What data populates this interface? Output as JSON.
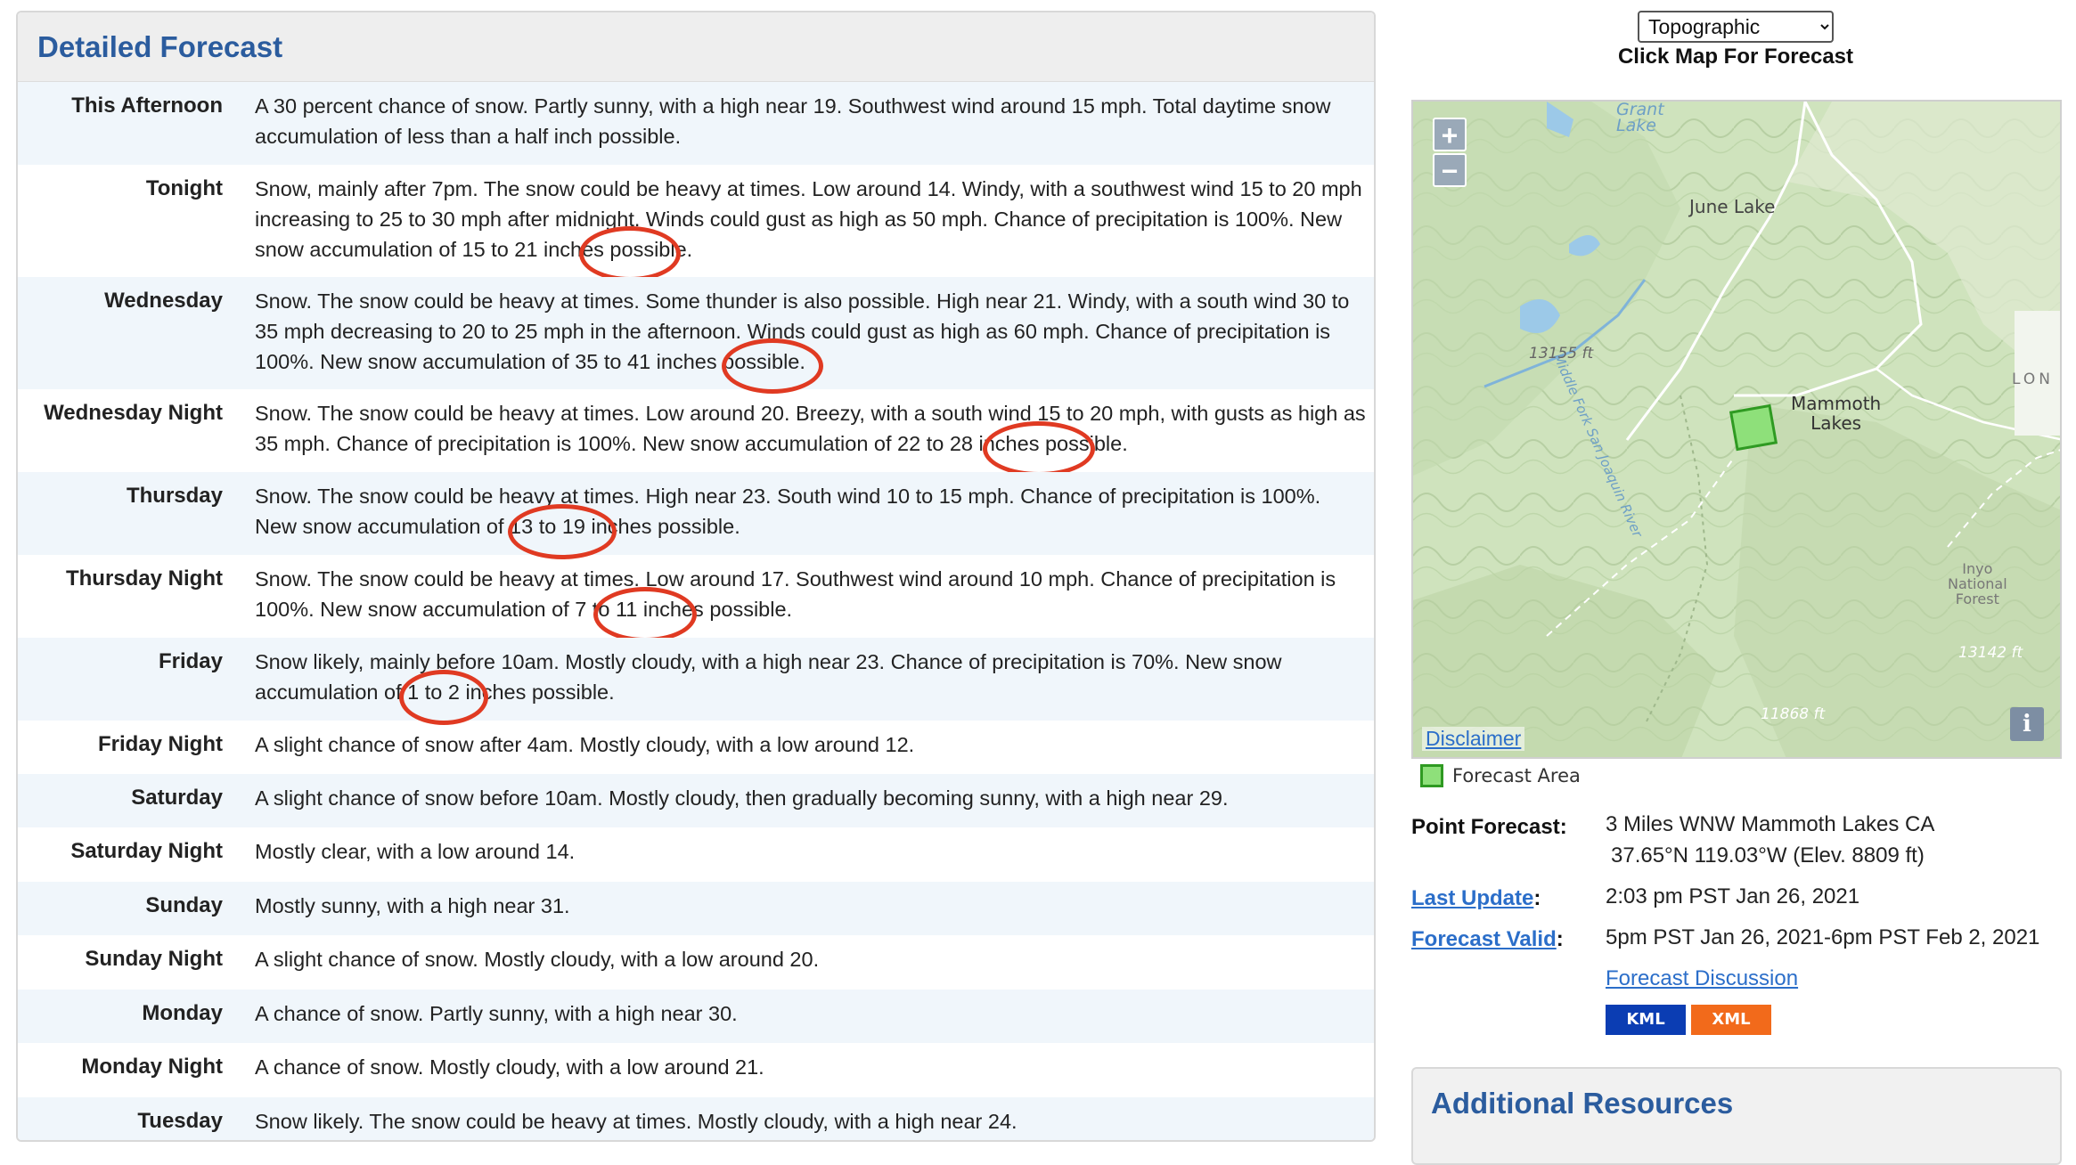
{
  "detailed_forecast": {
    "title": "Detailed Forecast",
    "periods": [
      {
        "name": "This Afternoon",
        "text": "A 30 percent chance of snow. Partly sunny, with a high near 19. Southwest wind around 15 mph. Total daytime snow accumulation of less than a half inch possible."
      },
      {
        "name": "Tonight",
        "text": "Snow, mainly after 7pm. The snow could be heavy at times. Low around 14. Windy, with a southwest wind 15 to 20 mph increasing to 25 to 30 mph after midnight. Winds could gust as high as 50 mph. Chance of precipitation is 100%. New snow accumulation of 15 to 21 inches possible."
      },
      {
        "name": "Wednesday",
        "text": "Snow. The snow could be heavy at times. Some thunder is also possible. High near 21. Windy, with a south wind 30 to 35 mph decreasing to 20 to 25 mph in the afternoon. Winds could gust as high as 60 mph. Chance of precipitation is 100%. New snow accumulation of 35 to 41 inches possible."
      },
      {
        "name": "Wednesday Night",
        "text": "Snow. The snow could be heavy at times. Low around 20. Breezy, with a south wind 15 to 20 mph, with gusts as high as 35 mph. Chance of precipitation is 100%. New snow accumulation of 22 to 28 inches possible."
      },
      {
        "name": "Thursday",
        "text": "Snow. The snow could be heavy at times. High near 23. South wind 10 to 15 mph. Chance of precipitation is 100%. New snow accumulation of 13 to 19 inches possible."
      },
      {
        "name": "Thursday Night",
        "text": "Snow. The snow could be heavy at times. Low around 17. Southwest wind around 10 mph. Chance of precipitation is 100%. New snow accumulation of 7 to 11 inches possible."
      },
      {
        "name": "Friday",
        "text": "Snow likely, mainly before 10am. Mostly cloudy, with a high near 23. Chance of precipitation is 70%. New snow accumulation of 1 to 2 inches possible."
      },
      {
        "name": "Friday Night",
        "text": "A slight chance of snow after 4am. Mostly cloudy, with a low around 12."
      },
      {
        "name": "Saturday",
        "text": "A slight chance of snow before 10am. Mostly cloudy, then gradually becoming sunny, with a high near 29."
      },
      {
        "name": "Saturday Night",
        "text": "Mostly clear, with a low around 14."
      },
      {
        "name": "Sunday",
        "text": "Mostly sunny, with a high near 31."
      },
      {
        "name": "Sunday Night",
        "text": "A slight chance of snow. Mostly cloudy, with a low around 20."
      },
      {
        "name": "Monday",
        "text": "A chance of snow. Partly sunny, with a high near 30."
      },
      {
        "name": "Monday Night",
        "text": "A chance of snow. Mostly cloudy, with a low around 21."
      },
      {
        "name": "Tuesday",
        "text": "Snow likely. The snow could be heavy at times. Mostly cloudy, with a high near 24."
      }
    ]
  },
  "map": {
    "type_selected": "Topographic",
    "caption": "Click Map For Forecast",
    "zoom_in": "+",
    "zoom_out": "−",
    "disclaimer": "Disclaimer",
    "info": "i",
    "labels": {
      "grant_lake": "Grant\nLake",
      "june_lake": "June Lake",
      "river": "Middle Fork San Joaquin River",
      "elev_1": "13155 ft",
      "mammoth_lakes": "Mammoth\nLakes",
      "lon": "LON",
      "inyo": "Inyo\nNational\nForest",
      "elev_2": "13142 ft",
      "elev_3": "11868 ft"
    },
    "legend_label": "Forecast Area"
  },
  "point_info": {
    "point_forecast_label": "Point Forecast:",
    "location": "3 Miles WNW Mammoth Lakes CA",
    "coordinates": "37.65°N 119.03°W (Elev. 8809 ft)",
    "last_update_label": "Last Update",
    "last_update": "2:03 pm PST Jan 26, 2021",
    "forecast_valid_label": "Forecast Valid",
    "forecast_valid": "5pm PST Jan 26, 2021-6pm PST Feb 2, 2021",
    "discussion_link": "Forecast Discussion",
    "kml": "KML",
    "xml": "XML",
    "colon": ":"
  },
  "additional_resources": {
    "title": "Additional Resources"
  },
  "colors": {
    "heading": "#2b5c9e",
    "link": "#2b6ec9",
    "highlight_ring": "#e03a22",
    "kml": "#0b3db3",
    "xml": "#f26a1b",
    "forecast_area": "#8ee07a"
  }
}
